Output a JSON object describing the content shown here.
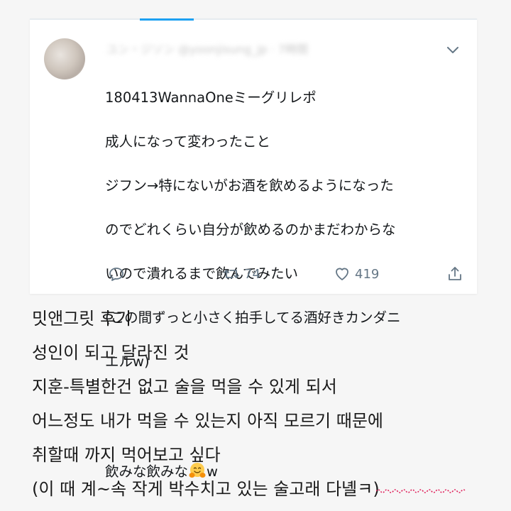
{
  "tweet": {
    "user_line_blurred": "ユン・ジソン @yoonjisung_jp · 7時間",
    "lines": [
      "180413WannaOneミーグリレポ",
      "成人になって変わったこと",
      "ジフン→特にないがお酒を飲めるようになった",
      "のでどれくらい自分が飲めるのかまだわからな",
      "いので潰れるまで飲んでみたい",
      "(この間ずっと小さく拍手してる酒好きカンダニ",
      "エルw)",
      "",
      "飲みな飲みな"
    ],
    "emoji_after": "w",
    "emoji_name": "hugging-face-icon",
    "retweets": "74",
    "likes": "419"
  },
  "translation": {
    "lines": [
      "밋앤그릿 후기",
      "성인이 되고 달라진 것",
      "지훈-특별한건 없고 술을 먹을 수 있게 되서",
      "어느정도 내가 먹을 수 있는지 아직 모르기 때문에",
      "취할때 까지 먹어보고 싶다",
      "(이 때 계~속 작게 박수치고 있는 술고래 다녤ㅋ)"
    ]
  },
  "colors": {
    "accent": "#1da1f2",
    "icon_gray": "#657786",
    "underline_red": "#e0245e"
  }
}
